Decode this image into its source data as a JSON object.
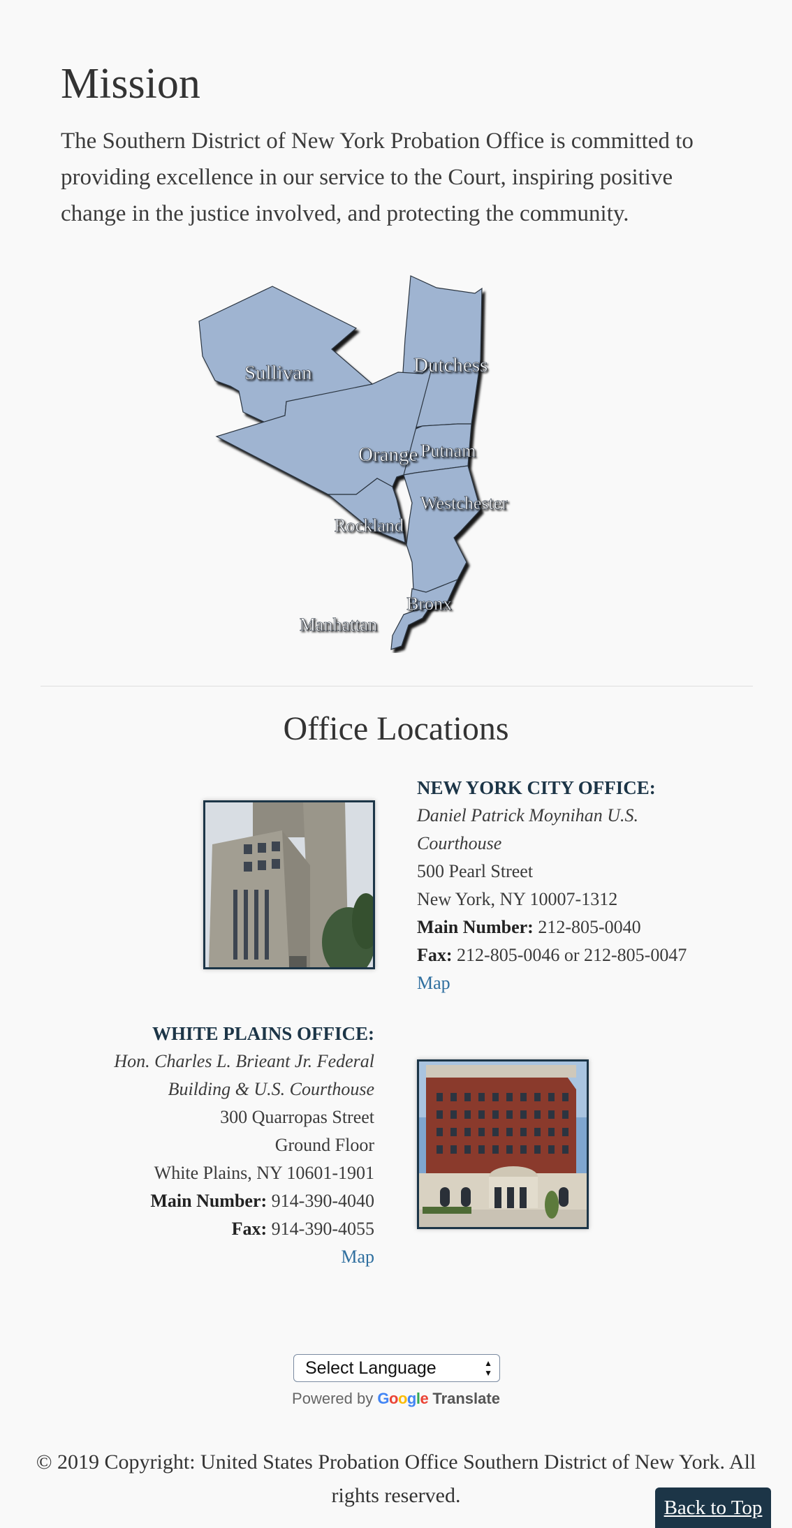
{
  "mission": {
    "title": "Mission",
    "text": "The Southern District of New York Probation Office is committed to providing excellence in our service to the Court, inspiring positive change in the justice involved, and protecting the community."
  },
  "district_map": {
    "counties": [
      "Sullivan",
      "Dutchess",
      "Orange",
      "Putnam",
      "Westchester",
      "Rockland",
      "Bronx",
      "Manhattan"
    ],
    "fill_color": "#9fb4d1"
  },
  "offices": {
    "title": "Office Locations",
    "nyc": {
      "name": "NEW YORK CITY OFFICE:",
      "building": "Daniel Patrick Moynihan U.S. Courthouse",
      "street": "500 Pearl Street",
      "city": "New York, NY 10007-1312",
      "main_label": "Main Number:",
      "main_value": "212-805-0040",
      "fax_label": "Fax:",
      "fax_value": "212-805-0046 or 212-805-0047",
      "map_link": "Map"
    },
    "white_plains": {
      "name": "WHITE PLAINS OFFICE:",
      "building": "Hon. Charles L. Brieant Jr. Federal Building & U.S. Courthouse",
      "street": "300 Quarropas Street",
      "floor": "Ground Floor",
      "city": "White Plains, NY 10601-1901",
      "main_label": "Main Number:",
      "main_value": "914-390-4040",
      "fax_label": "Fax:",
      "fax_value": "914-390-4055",
      "map_link": "Map"
    }
  },
  "translate": {
    "select_label": "Select Language",
    "powered_by": "Powered by",
    "google": "Google",
    "translate": "Translate"
  },
  "footer": {
    "copyright": "© 2019 Copyright: United States Probation Office Southern District of New York. All rights reserved.",
    "back_to_top": "Back to Top"
  },
  "colors": {
    "accent": "#1c3547",
    "link": "#2f6f9f",
    "background": "#f9f9f9"
  }
}
